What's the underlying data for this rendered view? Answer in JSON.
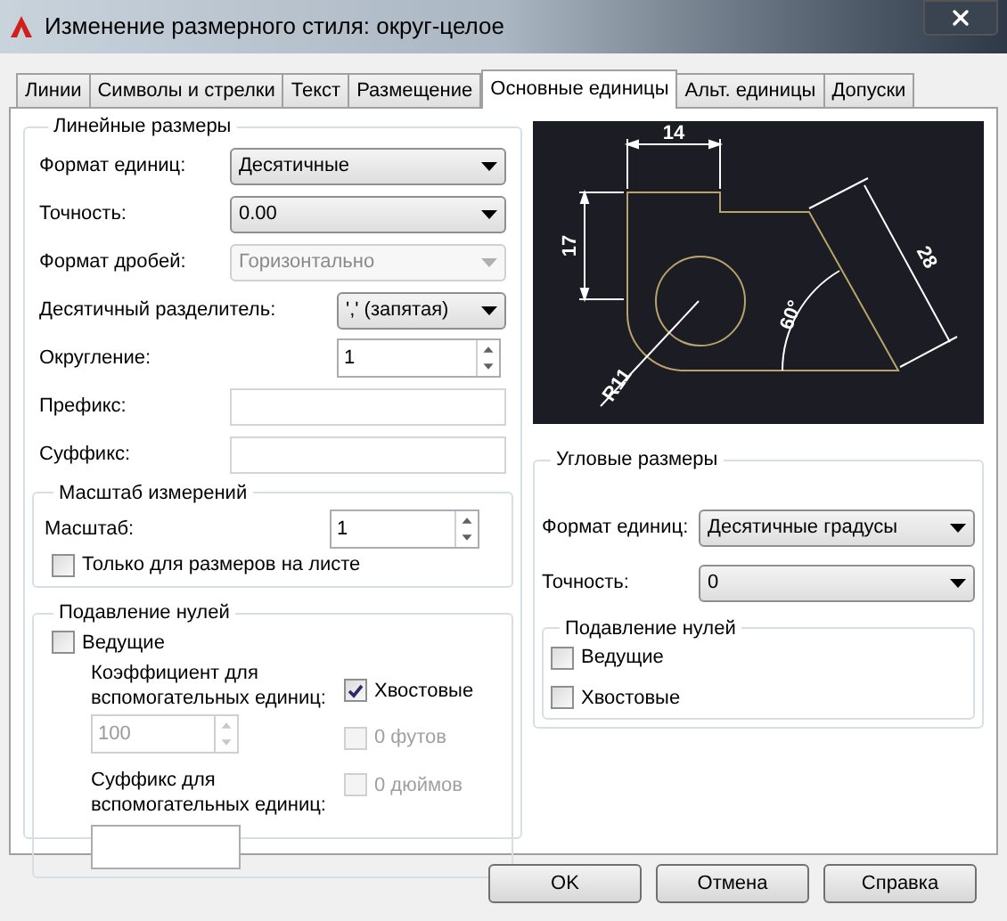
{
  "window": {
    "title": "Изменение размерного стиля: округ-целое"
  },
  "tabs": [
    {
      "label": "Линии",
      "selected": false
    },
    {
      "label": "Символы и стрелки",
      "selected": false
    },
    {
      "label": "Текст",
      "selected": false
    },
    {
      "label": "Размещение",
      "selected": false
    },
    {
      "label": "Основные единицы",
      "selected": true
    },
    {
      "label": "Альт. единицы",
      "selected": false
    },
    {
      "label": "Допуски",
      "selected": false
    }
  ],
  "linear": {
    "legend": "Линейные размеры",
    "fields": [
      {
        "kind": "select",
        "label": "Формат единиц:",
        "value": "Десятичные",
        "disabled": false
      },
      {
        "kind": "select",
        "label": "Точность:",
        "value": "0.00",
        "disabled": false
      },
      {
        "kind": "select",
        "label": "Формат дробей:",
        "value": "Горизонтально",
        "disabled": true
      },
      {
        "kind": "select",
        "label": "Десятичный  разделитель:",
        "value": "',' (запятая)",
        "disabled": false
      },
      {
        "kind": "spinner",
        "label": "Округление:",
        "value": "1",
        "disabled": false
      },
      {
        "kind": "text",
        "label": "Префикс:"
      },
      {
        "kind": "text",
        "label": "Суффикс:"
      }
    ]
  },
  "scale": {
    "legend": "Масштаб измерений",
    "label": "Масштаб:",
    "value": "1",
    "layout_only": {
      "label": "Только для размеров на листе",
      "checked": false
    }
  },
  "zero_suppression": {
    "legend": "Подавление нулей",
    "leading": {
      "label": "Ведущие",
      "checked": false,
      "disabled": false
    },
    "sub_factor": {
      "label": "Коэффициент для вспомогательных единиц:",
      "value": "100",
      "disabled": true
    },
    "sub_suffix": {
      "label": "Суффикс для вспомогательных единиц:"
    },
    "options": [
      {
        "label": "Хвостовые",
        "checked": true,
        "disabled": false
      },
      {
        "label": "0 футов",
        "checked": false,
        "disabled": true
      },
      {
        "label": "0 дюймов",
        "checked": false,
        "disabled": true
      }
    ]
  },
  "preview": {
    "labels": [
      "14",
      "17",
      "28",
      "60°",
      "R11"
    ]
  },
  "angular": {
    "legend": "Угловые размеры",
    "fields": [
      {
        "kind": "select",
        "label": "Формат единиц:",
        "value": "Десятичные градусы",
        "disabled": false
      },
      {
        "kind": "select",
        "label": "Точность:",
        "value": "0",
        "disabled": false
      }
    ],
    "zero_suppression": {
      "legend": "Подавление нулей",
      "options": [
        {
          "label": "Ведущие",
          "checked": false,
          "disabled": false
        },
        {
          "label": "Хвостовые",
          "checked": false,
          "disabled": false
        }
      ]
    }
  },
  "buttons": [
    "OK",
    "Отмена",
    "Справка"
  ]
}
